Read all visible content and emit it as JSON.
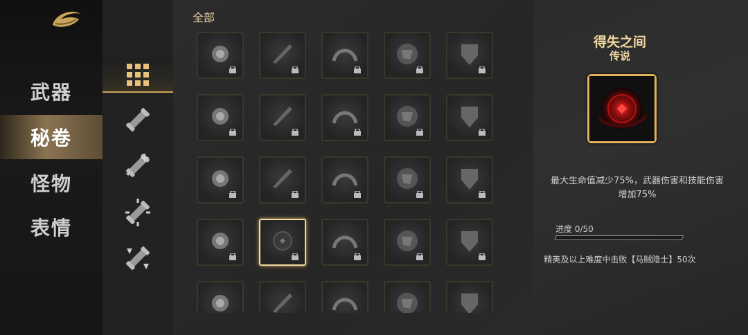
{
  "nav": {
    "items": [
      {
        "label": "武器",
        "active": false
      },
      {
        "label": "秘卷",
        "active": true
      },
      {
        "label": "怪物",
        "active": false
      },
      {
        "label": "表情",
        "active": false
      }
    ]
  },
  "subnav": {
    "items": [
      {
        "icon": "grid-icon",
        "active": true
      },
      {
        "icon": "scroll-plain-icon",
        "active": false
      },
      {
        "icon": "scroll-sparkle-icon",
        "active": false
      },
      {
        "icon": "scroll-burst-icon",
        "active": false
      },
      {
        "icon": "scroll-arrows-icon",
        "active": false
      }
    ]
  },
  "main": {
    "title": "全部",
    "cells": [
      {
        "icon": "burst-glow-icon",
        "locked": true
      },
      {
        "icon": "blade-slash-icon",
        "locked": true
      },
      {
        "icon": "arch-gems-icon",
        "locked": true
      },
      {
        "icon": "orb-fold-icon",
        "locked": true
      },
      {
        "icon": "shield-broken-icon",
        "locked": true
      },
      {
        "icon": "gauntlet-icon",
        "locked": true
      },
      {
        "icon": "vortex-ring-icon",
        "locked": true
      },
      {
        "icon": "halo-ring-icon",
        "locked": true
      },
      {
        "icon": "wind-blast-icon",
        "locked": true
      },
      {
        "icon": "arrow-up-icon",
        "locked": true
      },
      {
        "icon": "dash-ring-icon",
        "locked": true
      },
      {
        "icon": "bat-wing-icon",
        "locked": true
      },
      {
        "icon": "spiral-rune-icon",
        "locked": true
      },
      {
        "icon": "horned-helm-icon",
        "locked": true
      },
      {
        "icon": "gear-nut-icon",
        "locked": true
      },
      {
        "icon": "spike-claw-icon",
        "locked": true
      },
      {
        "icon": "red-orb-icon",
        "locked": true,
        "selected": true
      },
      {
        "icon": "cat-statue-icon",
        "locked": true
      },
      {
        "icon": "crest-emblem-icon",
        "locked": true
      },
      {
        "icon": "yin-swirl-icon",
        "locked": true
      },
      {
        "icon": "stone-block-icon",
        "locked": true
      },
      {
        "icon": "star-flare-icon",
        "locked": true
      },
      {
        "icon": "shatter-icon",
        "locked": true
      },
      {
        "icon": "wolf-head-icon",
        "locked": true
      },
      {
        "icon": "flame-icon",
        "locked": true
      }
    ]
  },
  "detail": {
    "title": "得失之间",
    "rarity": "传说",
    "description": "最大生命值减少75%，武器伤害和技能伤害增加75%",
    "progress_label": "进度 0/50",
    "progress": {
      "current": 0,
      "max": 50
    },
    "task": "精英及以上难度中击败【马贼隐士】50次"
  },
  "colors": {
    "accent": "#e3b15a",
    "gold_text": "#f0d8a0"
  }
}
